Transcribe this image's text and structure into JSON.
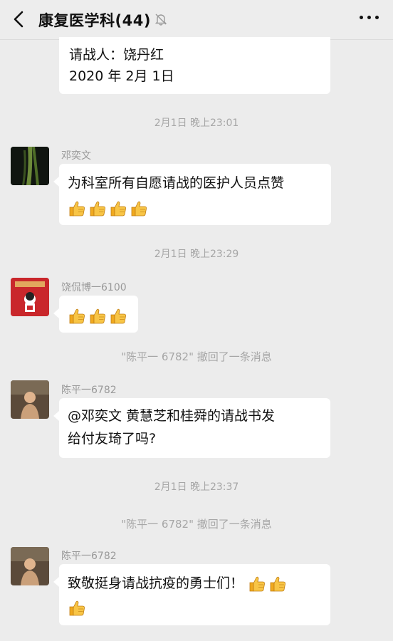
{
  "header": {
    "title": "康复医学科(44)"
  },
  "messages": {
    "m0": {
      "line1": "请战人：饶丹红",
      "line2": "2020 年 2月 1日"
    },
    "ts1": "2月1日 晚上23:01",
    "m1": {
      "sender": "邓奕文",
      "text": "为科室所有自愿请战的医护人员点赞",
      "thumbs": 4
    },
    "ts2": "2月1日 晚上23:29",
    "m2": {
      "sender": "饶侃博一6100",
      "thumbs": 3
    },
    "sys1": "\"陈平一 6782\" 撤回了一条消息",
    "m3": {
      "sender": "陈平一6782",
      "line1": "@邓奕文  黄慧芝和桂舜的请战书发",
      "line2": "给付友琦了吗?"
    },
    "ts3": "2月1日 晚上23:37",
    "sys2": "\"陈平一 6782\" 撤回了一条消息",
    "m4": {
      "sender": "陈平一6782",
      "text": "致敬挺身请战抗疫的勇士们！",
      "thumbs_after": 2,
      "thumbs_line2": 1
    }
  },
  "icons": {
    "back": "chevron-left-icon",
    "mute": "bell-off-icon",
    "more": "more-dots-icon",
    "thumb": "thumbs-up-emoji"
  },
  "colors": {
    "background": "#ececec",
    "bubble": "#ffffff",
    "timestamp": "#a6a6a6",
    "thumb": "#f5b93a"
  }
}
